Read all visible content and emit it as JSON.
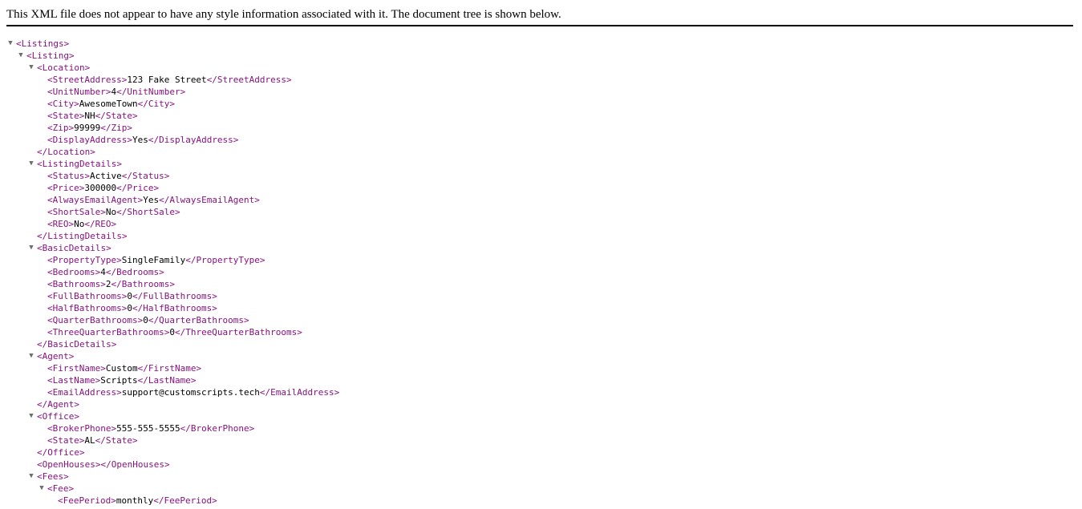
{
  "banner": {
    "message": "This XML file does not appear to have any style information associated with it. The document tree is shown below."
  },
  "tree": {
    "collapse_glyph": "▼",
    "lines": [
      {
        "depth": 0,
        "toggle": true,
        "open": "<Listings>",
        "text": "",
        "close": ""
      },
      {
        "depth": 1,
        "toggle": true,
        "open": "<Listing>",
        "text": "",
        "close": ""
      },
      {
        "depth": 2,
        "toggle": true,
        "open": "<Location>",
        "text": "",
        "close": ""
      },
      {
        "depth": 3,
        "toggle": false,
        "open": "<StreetAddress>",
        "text": "123 Fake Street",
        "close": "</StreetAddress>"
      },
      {
        "depth": 3,
        "toggle": false,
        "open": "<UnitNumber>",
        "text": "4",
        "close": "</UnitNumber>"
      },
      {
        "depth": 3,
        "toggle": false,
        "open": "<City>",
        "text": "AwesomeTown",
        "close": "</City>"
      },
      {
        "depth": 3,
        "toggle": false,
        "open": "<State>",
        "text": "NH",
        "close": "</State>"
      },
      {
        "depth": 3,
        "toggle": false,
        "open": "<Zip>",
        "text": "99999",
        "close": "</Zip>"
      },
      {
        "depth": 3,
        "toggle": false,
        "open": "<DisplayAddress>",
        "text": "Yes",
        "close": "</DisplayAddress>"
      },
      {
        "depth": 2,
        "toggle": false,
        "open": "",
        "text": "",
        "close": "</Location>"
      },
      {
        "depth": 2,
        "toggle": true,
        "open": "<ListingDetails>",
        "text": "",
        "close": ""
      },
      {
        "depth": 3,
        "toggle": false,
        "open": "<Status>",
        "text": "Active",
        "close": "</Status>"
      },
      {
        "depth": 3,
        "toggle": false,
        "open": "<Price>",
        "text": "300000",
        "close": "</Price>"
      },
      {
        "depth": 3,
        "toggle": false,
        "open": "<AlwaysEmailAgent>",
        "text": "Yes",
        "close": "</AlwaysEmailAgent>"
      },
      {
        "depth": 3,
        "toggle": false,
        "open": "<ShortSale>",
        "text": "No",
        "close": "</ShortSale>"
      },
      {
        "depth": 3,
        "toggle": false,
        "open": "<REO>",
        "text": "No",
        "close": "</REO>"
      },
      {
        "depth": 2,
        "toggle": false,
        "open": "",
        "text": "",
        "close": "</ListingDetails>"
      },
      {
        "depth": 2,
        "toggle": true,
        "open": "<BasicDetails>",
        "text": "",
        "close": ""
      },
      {
        "depth": 3,
        "toggle": false,
        "open": "<PropertyType>",
        "text": "SingleFamily",
        "close": "</PropertyType>"
      },
      {
        "depth": 3,
        "toggle": false,
        "open": "<Bedrooms>",
        "text": "4",
        "close": "</Bedrooms>"
      },
      {
        "depth": 3,
        "toggle": false,
        "open": "<Bathrooms>",
        "text": "2",
        "close": "</Bathrooms>"
      },
      {
        "depth": 3,
        "toggle": false,
        "open": "<FullBathrooms>",
        "text": "0",
        "close": "</FullBathrooms>"
      },
      {
        "depth": 3,
        "toggle": false,
        "open": "<HalfBathrooms>",
        "text": "0",
        "close": "</HalfBathrooms>"
      },
      {
        "depth": 3,
        "toggle": false,
        "open": "<QuarterBathrooms>",
        "text": "0",
        "close": "</QuarterBathrooms>"
      },
      {
        "depth": 3,
        "toggle": false,
        "open": "<ThreeQuarterBathrooms>",
        "text": "0",
        "close": "</ThreeQuarterBathrooms>"
      },
      {
        "depth": 2,
        "toggle": false,
        "open": "",
        "text": "",
        "close": "</BasicDetails>"
      },
      {
        "depth": 2,
        "toggle": true,
        "open": "<Agent>",
        "text": "",
        "close": ""
      },
      {
        "depth": 3,
        "toggle": false,
        "open": "<FirstName>",
        "text": "Custom",
        "close": "</FirstName>"
      },
      {
        "depth": 3,
        "toggle": false,
        "open": "<LastName>",
        "text": "Scripts",
        "close": "</LastName>"
      },
      {
        "depth": 3,
        "toggle": false,
        "open": "<EmailAddress>",
        "text": "support@customscripts.tech",
        "close": "</EmailAddress>"
      },
      {
        "depth": 2,
        "toggle": false,
        "open": "",
        "text": "",
        "close": "</Agent>"
      },
      {
        "depth": 2,
        "toggle": true,
        "open": "<Office>",
        "text": "",
        "close": ""
      },
      {
        "depth": 3,
        "toggle": false,
        "open": "<BrokerPhone>",
        "text": "555-555-5555",
        "close": "</BrokerPhone>"
      },
      {
        "depth": 3,
        "toggle": false,
        "open": "<State>",
        "text": "AL",
        "close": "</State>"
      },
      {
        "depth": 2,
        "toggle": false,
        "open": "",
        "text": "",
        "close": "</Office>"
      },
      {
        "depth": 2,
        "toggle": false,
        "open": "<OpenHouses>",
        "text": "",
        "close": "</OpenHouses>"
      },
      {
        "depth": 2,
        "toggle": true,
        "open": "<Fees>",
        "text": "",
        "close": ""
      },
      {
        "depth": 3,
        "toggle": true,
        "open": "<Fee>",
        "text": "",
        "close": ""
      },
      {
        "depth": 4,
        "toggle": false,
        "open": "<FeePeriod>",
        "text": "monthly",
        "close": "</FeePeriod>"
      }
    ]
  }
}
